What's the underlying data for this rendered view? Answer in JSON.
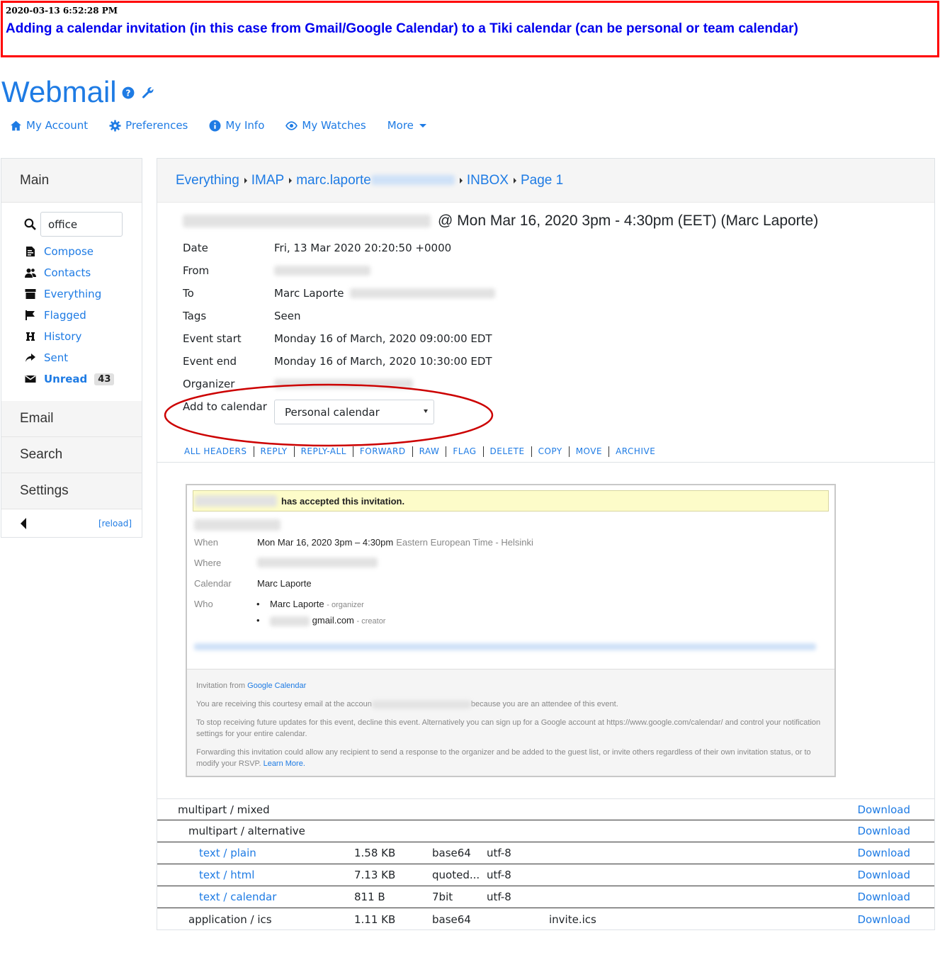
{
  "annotation": {
    "timestamp": "2020-03-13 6:52:28 PM",
    "title": "Adding a calendar invitation (in this case from Gmail/Google Calendar) to a Tiki calendar (can be personal or team calendar)"
  },
  "header": {
    "title": "Webmail"
  },
  "topnav": {
    "my_account": "My Account",
    "preferences": "Preferences",
    "my_info": "My Info",
    "my_watches": "My Watches",
    "more": "More"
  },
  "sidebar": {
    "main": "Main",
    "search_value": "office",
    "items": [
      {
        "label": "Compose"
      },
      {
        "label": "Contacts"
      },
      {
        "label": "Everything"
      },
      {
        "label": "Flagged"
      },
      {
        "label": "History"
      },
      {
        "label": "Sent"
      },
      {
        "label": "Unread",
        "count": "43"
      }
    ],
    "email": "Email",
    "search": "Search",
    "settings": "Settings",
    "reload": "[reload]"
  },
  "breadcrumb": {
    "everything": "Everything",
    "imap": "IMAP",
    "account": "marc.laporte",
    "inbox": "INBOX",
    "page": "Page 1"
  },
  "message": {
    "subject": "@ Mon Mar 16, 2020 3pm - 4:30pm (EET) (Marc Laporte)",
    "headers": {
      "date_label": "Date",
      "date": "Fri, 13 Mar 2020 20:20:50 +0000",
      "from_label": "From",
      "to_label": "To",
      "to": "Marc Laporte",
      "tags_label": "Tags",
      "tags": "Seen",
      "event_start_label": "Event start",
      "event_start": "Monday 16 of March, 2020 09:00:00 EDT",
      "event_end_label": "Event end",
      "event_end": "Monday 16 of March, 2020 10:30:00 EDT",
      "organizer_label": "Organizer",
      "add_to_calendar_label": "Add to calendar",
      "calendar_selected": "Personal calendar"
    },
    "actions": [
      "ALL HEADERS",
      "REPLY",
      "REPLY-ALL",
      "FORWARD",
      "RAW",
      "FLAG",
      "DELETE",
      "COPY",
      "MOVE",
      "ARCHIVE"
    ]
  },
  "invite": {
    "banner": "has accepted this invitation.",
    "when_label": "When",
    "when": "Mon Mar 16, 2020 3pm – 4:30pm",
    "when_tz": "Eastern European Time - Helsinki",
    "where_label": "Where",
    "calendar_label": "Calendar",
    "calendar": "Marc Laporte",
    "who_label": "Who",
    "who_1": "Marc Laporte",
    "who_1_role": "- organizer",
    "who_2": "gmail.com",
    "who_2_role": "- creator",
    "footer_1_a": "Invitation from ",
    "footer_1_link": "Google Calendar",
    "footer_2_a": "You are receiving this courtesy email at the accoun",
    "footer_2_b": "because you are an attendee of this event.",
    "footer_3": "To stop receiving future updates for this event, decline this event. Alternatively you can sign up for a Google account at https://www.google.com/calendar/ and control your notification settings for your entire calendar.",
    "footer_4": "Forwarding this invitation could allow any recipient to send a response to the organizer and be added to the guest list, or invite others regardless of their own invitation status, or to modify your RSVP.",
    "footer_4_link": "Learn More."
  },
  "parts": [
    {
      "type": "multipart / mixed",
      "size": "",
      "enc": "",
      "cs": "",
      "fname": "",
      "dl": "Download"
    },
    {
      "type": "multipart / alternative",
      "size": "",
      "enc": "",
      "cs": "",
      "fname": "",
      "dl": "Download"
    },
    {
      "type": "text / plain",
      "size": "1.58 KB",
      "enc": "base64",
      "cs": "utf-8",
      "fname": "",
      "dl": "Download"
    },
    {
      "type": "text / html",
      "size": "7.13 KB",
      "enc": "quoted...",
      "cs": "utf-8",
      "fname": "",
      "dl": "Download"
    },
    {
      "type": "text / calendar",
      "size": "811 B",
      "enc": "7bit",
      "cs": "utf-8",
      "fname": "",
      "dl": "Download"
    },
    {
      "type": "application / ics",
      "size": "1.11 KB",
      "enc": "base64",
      "cs": "",
      "fname": "invite.ics",
      "dl": "Download"
    }
  ],
  "colors": {
    "link": "#1e7be4",
    "annotation_border": "#ff0000",
    "annotation_title": "#0000ee",
    "highlight_ellipse": "#cc0000"
  }
}
